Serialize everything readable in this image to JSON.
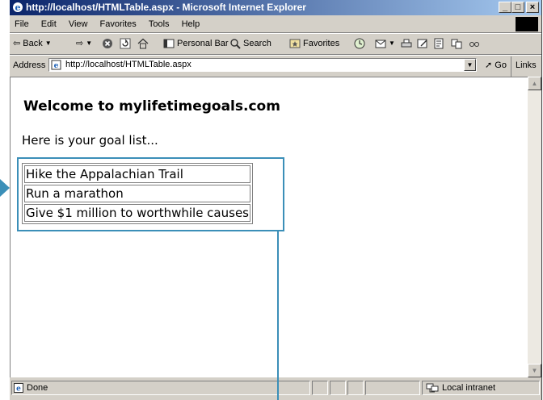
{
  "window": {
    "title": "http://localhost/HTMLTable.aspx - Microsoft Internet Explorer",
    "controls": {
      "minimize": "_",
      "maximize": "□",
      "close": "×"
    }
  },
  "menu": [
    "File",
    "Edit",
    "View",
    "Favorites",
    "Tools",
    "Help"
  ],
  "toolbar": {
    "back": "⇦ Back",
    "forward": "⇨",
    "personal_bar": "Personal Bar",
    "search": "Search",
    "favorites": "Favorites"
  },
  "address": {
    "label": "Address",
    "url": "http://localhost/HTMLTable.aspx",
    "go": "Go",
    "links": "Links »"
  },
  "page": {
    "heading": "Welcome to mylifetimegoals.com",
    "intro": "Here is your goal list...",
    "goals": [
      "Hike the Appalachian Trail",
      "Run a marathon",
      "Give $1 million to worthwhile causes"
    ]
  },
  "status": {
    "text": "Done",
    "zone": "Local intranet"
  },
  "colors": {
    "titlebar_start": "#0a246a",
    "titlebar_end": "#a6caf0",
    "chrome": "#d4d0c8",
    "callout": "#3b8fb8"
  }
}
